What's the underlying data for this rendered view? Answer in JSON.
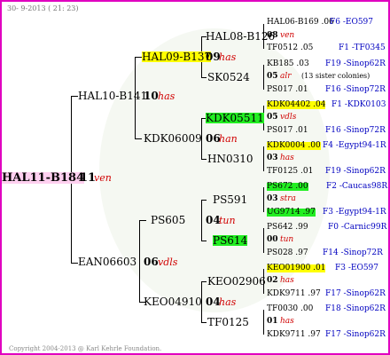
{
  "header": {
    "date": "30-  9-2013 ( 21: 23)"
  },
  "footer": {
    "copyright": "Copyright 2004-2013 @ Karl Kehrle Foundation."
  },
  "root": {
    "name": "HAL11-B184",
    "year": "11",
    "race": "ven"
  },
  "gen1": [
    {
      "name": "HAL10-B141",
      "year": "10",
      "race": "has"
    },
    {
      "name": "EAN06603",
      "year": "06",
      "race": "vdls"
    }
  ],
  "gen2": [
    {
      "name": "HAL09-B137",
      "year": "09",
      "race": "has"
    },
    {
      "name": "KDK06009",
      "year": "06",
      "race": "han"
    },
    {
      "name": "PS605",
      "year": "04",
      "race": "tun"
    },
    {
      "name": "KEO04910",
      "year": "04",
      "race": "has"
    }
  ],
  "gen3": [
    {
      "name": "HAL08-B126",
      "year": "08",
      "race": "ven"
    },
    {
      "name": "SK0524",
      "year": "05",
      "race": "alr"
    },
    {
      "name": "KDK05511",
      "year": "05",
      "race": "vdls"
    },
    {
      "name": "HN0310",
      "year": "03",
      "race": "has"
    },
    {
      "name": "PS591",
      "year": "03",
      "race": "stra"
    },
    {
      "name": "PS614",
      "year": "00",
      "race": "tun"
    },
    {
      "name": "KEO02906",
      "year": "02",
      "race": "has"
    },
    {
      "name": "TF0125",
      "year": "01",
      "race": "has"
    }
  ],
  "gen4": [
    {
      "name": "HAL06-B169 .06",
      "code": "F6 -EO597"
    },
    {
      "name": "TF0512 .05",
      "code": "F1 -TF0345"
    },
    {
      "name": "KB185 .03",
      "code": "F19 -Sinop62R"
    },
    {
      "name": "PS017 .01",
      "code": "F16 -Sinop72R"
    },
    {
      "name": "KDK04402 .04",
      "code": "F1 -KDK0103"
    },
    {
      "name": "PS017 .01",
      "code": "F16 -Sinop72R"
    },
    {
      "name": "KDK0004 .00",
      "code": "F4 -Egypt94-1R"
    },
    {
      "name": "TF0125 .01",
      "code": "F19 -Sinop62R"
    },
    {
      "name": "PS672 .00",
      "code": "F2 -Caucas98R"
    },
    {
      "name": "UG9714 .97",
      "code": "F3 -Egypt94-1R"
    },
    {
      "name": "PS642 .99",
      "code": "F0 -Carnic99R"
    },
    {
      "name": "PS028 .97",
      "code": "F14 -Sinop72R"
    },
    {
      "name": "KEO01900 .01",
      "code": "F3 -EO597"
    },
    {
      "name": "KDK9711 .97",
      "code": "F17 -Sinop62R"
    },
    {
      "name": "TF0030 .00",
      "code": "F18 -Sinop62R"
    },
    {
      "name": "KDK9711 .97",
      "code": "F17 -Sinop62R"
    }
  ],
  "note": "(13 sister colonies)"
}
